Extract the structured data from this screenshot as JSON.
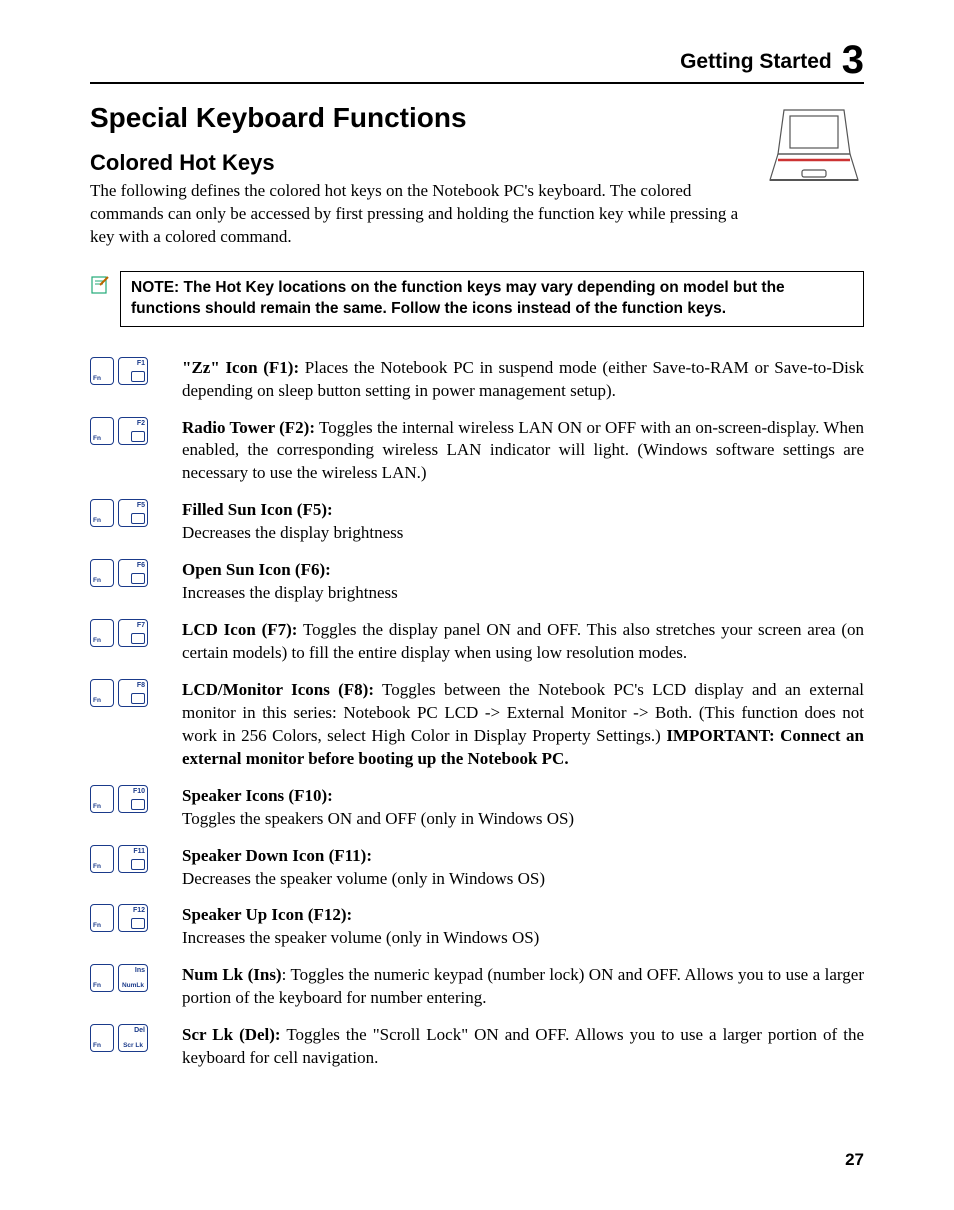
{
  "header": {
    "chapter_label": "Getting Started",
    "chapter_number": "3"
  },
  "title": "Special Keyboard Functions",
  "subtitle": "Colored Hot Keys",
  "intro": "The following defines the colored hot keys on the Notebook PC's keyboard. The colored commands can only be accessed by first pressing and holding the function key while pressing a key with a colored command.",
  "note": "NOTE: The Hot Key locations on the function keys may vary depending on model but the functions should remain the same. Follow the icons instead of the function keys.",
  "items": [
    {
      "fn_label": "Fn",
      "key_top": "F1",
      "key_bot": "",
      "head": "\"Zz\" Icon (F1):",
      "body": " Places the Notebook PC in suspend mode (either Save-to-RAM or Save-to-Disk depending on sleep button setting in power management setup)."
    },
    {
      "fn_label": "Fn",
      "key_top": "F2",
      "key_bot": "",
      "head": "Radio Tower (F2):",
      "body": " Toggles the internal wireless LAN ON or OFF with an on-screen-display. When enabled, the corresponding wireless LAN indicator will light. (Windows software settings are necessary to use the wireless LAN.)"
    },
    {
      "fn_label": "Fn",
      "key_top": "F5",
      "key_bot": "",
      "head": "Filled Sun Icon (F5):",
      "body": "\nDecreases the display brightness"
    },
    {
      "fn_label": "Fn",
      "key_top": "F6",
      "key_bot": "",
      "head": "Open Sun Icon (F6):",
      "body": "\nIncreases the display brightness"
    },
    {
      "fn_label": "Fn",
      "key_top": "F7",
      "key_bot": "",
      "head": "LCD Icon (F7):",
      "body": " Toggles the display panel ON and OFF. This also stretches your screen area (on certain models) to fill the entire display when using low resolution modes."
    },
    {
      "fn_label": "Fn",
      "key_top": "F8",
      "key_bot": "",
      "head": "LCD/Monitor Icons (F8):",
      "body": " Toggles between the Notebook PC's LCD display and an external monitor in this series: Notebook PC LCD -> External Monitor -> Both. (This function does not work in 256 Colors, select High Color in Display Property Settings.) ",
      "tail_bold": "IMPORTANT: Connect an external monitor before booting up the Notebook PC."
    },
    {
      "fn_label": "Fn",
      "key_top": "F10",
      "key_bot": "",
      "head": "Speaker Icons (F10):",
      "body": "\nToggles the speakers ON and OFF (only in Windows OS)"
    },
    {
      "fn_label": "Fn",
      "key_top": "F11",
      "key_bot": "",
      "head": "Speaker Down Icon (F11):",
      "body": "\nDecreases the speaker volume (only in Windows OS)"
    },
    {
      "fn_label": "Fn",
      "key_top": "F12",
      "key_bot": "",
      "head": "Speaker Up Icon (F12):",
      "body": "\nIncreases the speaker volume (only in Windows OS)"
    },
    {
      "fn_label": "Fn",
      "key_top": "Ins",
      "key_bot": "NumLk",
      "head": "Num Lk (Ins)",
      "body": ": Toggles the numeric keypad (number lock) ON and OFF. Allows you to use a larger portion of the keyboard for number entering."
    },
    {
      "fn_label": "Fn",
      "key_top": "Del",
      "key_bot": "Scr Lk",
      "head": "Scr Lk (Del):",
      "body": " Toggles the \"Scroll Lock\" ON and OFF. Allows you to use a larger portion of the keyboard for cell navigation."
    }
  ],
  "page_number": "27"
}
